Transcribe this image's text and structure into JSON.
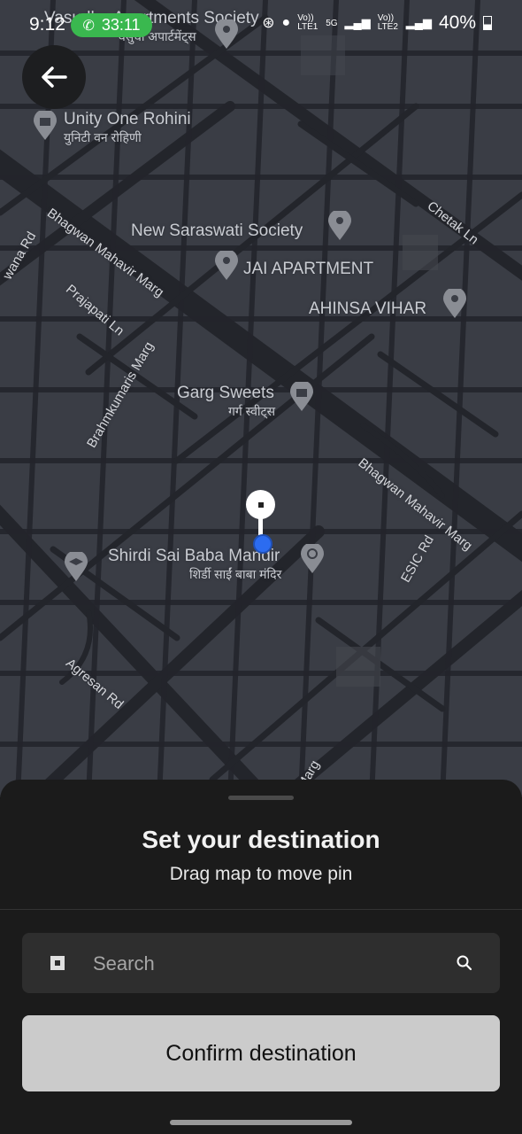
{
  "status_bar": {
    "time": "9:12",
    "call_timer": "33:11",
    "carrier_a": "Vo)) LTE1",
    "carrier_b": "Vo)) LTE2",
    "network": "5G",
    "battery": "40%"
  },
  "map": {
    "places": [
      {
        "name": "Vasudha Apartments Society",
        "hindi": "वसुधा अपार्टमेंट्स"
      },
      {
        "name": "Unity One Rohini",
        "hindi": "युनिटी वन रोहिणी"
      },
      {
        "name": "New Saraswati Society",
        "hindi": ""
      },
      {
        "name": "JAI APARTMENT",
        "hindi": ""
      },
      {
        "name": "AHINSA VIHAR",
        "hindi": ""
      },
      {
        "name": "Garg Sweets",
        "hindi": "गर्ग स्वीट्स"
      },
      {
        "name": "Shirdi Sai Baba Mandir",
        "hindi": "शिर्डी साईं बाबा मंदिर"
      }
    ],
    "roads": [
      "Bhagwan Mahavir Marg",
      "Prajapati Ln",
      "Brahmkumaris Marg",
      "Chetak Ln",
      "Bhagwan Mahavir Marg",
      "ESIC Rd",
      "Agresan Rd",
      "wana Rd",
      "Marg"
    ],
    "colors": {
      "background": "#3a3d45",
      "road": "#23252b",
      "pin_dot": "#2c6cf0"
    }
  },
  "sheet": {
    "title": "Set your destination",
    "subtitle": "Drag map to move pin",
    "search_placeholder": "Search",
    "confirm_label": "Confirm destination"
  }
}
